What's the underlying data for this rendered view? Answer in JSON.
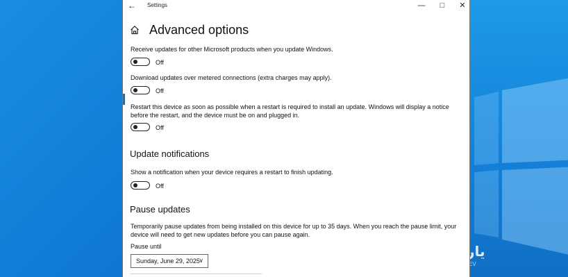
{
  "window": {
    "title": "Settings",
    "back_icon": "←",
    "minimize_icon": "—",
    "maximize_icon": "□",
    "close_icon": "✕"
  },
  "page": {
    "title": "Advanced options"
  },
  "settings": [
    {
      "description": "Receive updates for other Microsoft products when you update Windows.",
      "state": "Off"
    },
    {
      "description": "Download updates over metered connections (extra charges may apply).",
      "state": "Off"
    },
    {
      "description": "Restart this device as soon as possible when a restart is required to install an update. Windows will display a notice before the restart, and the device must be on and plugged in.",
      "state": "Off"
    }
  ],
  "notifications": {
    "header": "Update notifications",
    "description": "Show a notification when your device requires a restart to finish updating.",
    "state": "Off"
  },
  "pause": {
    "header": "Pause updates",
    "description": "Temporarily pause updates from being installed on this device for up to 35 days. When you reach the pause limit, your device will need to get new updates before you can pause again.",
    "label": "Pause until",
    "date_value": "Sunday, June 29, 2025",
    "chevron_icon": "∨"
  },
  "watermark": {
    "text": "يار",
    "sub": "EV"
  }
}
